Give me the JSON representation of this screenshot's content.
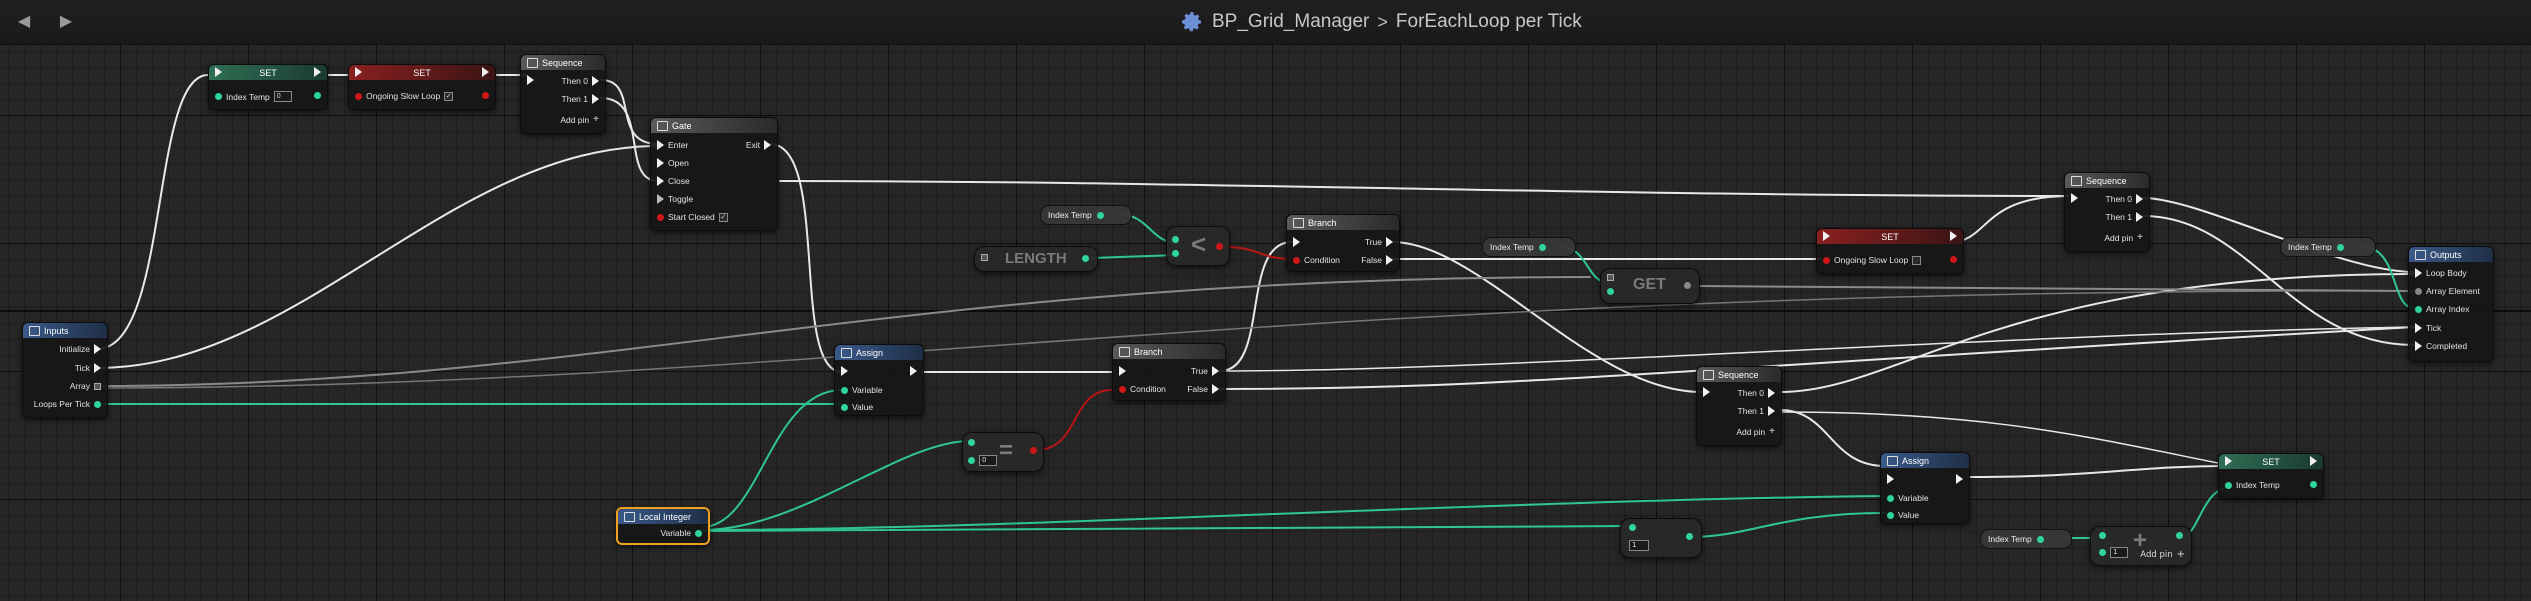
{
  "window": {
    "back_icon": "back-arrow-icon",
    "forward_icon": "forward-arrow-icon"
  },
  "breadcrumb": {
    "graph_icon": "gear-icon",
    "blueprint": "BP_Grid_Manager",
    "separator": ">",
    "graph": "ForEachLoop per Tick"
  },
  "colors": {
    "exec": "#f0f0f0",
    "int_pin": "#2fd69a",
    "bool_pin": "#d01717",
    "wire_int": "#2fc596",
    "wire_exec": "#e8e8e8",
    "selected_outline": "#f0a020"
  },
  "nodes": {
    "set1": {
      "title": "SET",
      "pin": "Index Temp",
      "value": "0"
    },
    "set2": {
      "title": "SET",
      "pin": "Ongoing Slow Loop",
      "value": "✓"
    },
    "seq1": {
      "title": "Sequence",
      "then0": "Then 0",
      "then1": "Then 1",
      "addpin": "Add pin"
    },
    "gate": {
      "title": "Gate",
      "enter": "Enter",
      "exit": "Exit",
      "open": "Open",
      "close": "Close",
      "toggle": "Toggle",
      "start_closed": "Start Closed",
      "start_closed_value": "✓"
    },
    "inputs": {
      "title": "Inputs",
      "initialize": "Initialize",
      "tick": "Tick",
      "array": "Array",
      "loops": "Loops Per Tick"
    },
    "assign1": {
      "title": "Assign",
      "variable": "Variable",
      "value": "Value"
    },
    "local_int": {
      "title": "Local Integer",
      "variable": "Variable"
    },
    "equal": {
      "value": "0"
    },
    "length": {
      "label": "LENGTH"
    },
    "index_temp_1": {
      "label": "Index Temp"
    },
    "less": {
      "label": "<"
    },
    "branch1": {
      "title": "Branch",
      "true": "True",
      "condition": "Condition",
      "false": "False"
    },
    "branch2": {
      "title": "Branch",
      "true": "True",
      "condition": "Condition",
      "false": "False"
    },
    "index_temp_2": {
      "label": "Index Temp"
    },
    "get": {
      "label": "GET"
    },
    "set3": {
      "title": "SET",
      "pin": "Ongoing Slow Loop",
      "value": ""
    },
    "seq2": {
      "title": "Sequence",
      "then0": "Then 0",
      "then1": "Then 1",
      "addpin": "Add pin"
    },
    "seq3": {
      "title": "Sequence",
      "then0": "Then 0",
      "then1": "Then 1",
      "addpin": "Add pin"
    },
    "index_temp_3": {
      "label": "Index Temp"
    },
    "outputs": {
      "title": "Outputs",
      "loop_body": "Loop Body",
      "array_element": "Array Element",
      "array_index": "Array Index",
      "tick": "Tick",
      "completed": "Completed"
    },
    "assign2": {
      "title": "Assign",
      "variable": "Variable",
      "value": "Value"
    },
    "one": {
      "value": "1"
    },
    "set4": {
      "title": "SET",
      "pin": "Index Temp"
    },
    "index_temp_4": {
      "label": "Index Temp"
    },
    "add": {
      "value": "1",
      "addpin": "Add pin"
    }
  }
}
